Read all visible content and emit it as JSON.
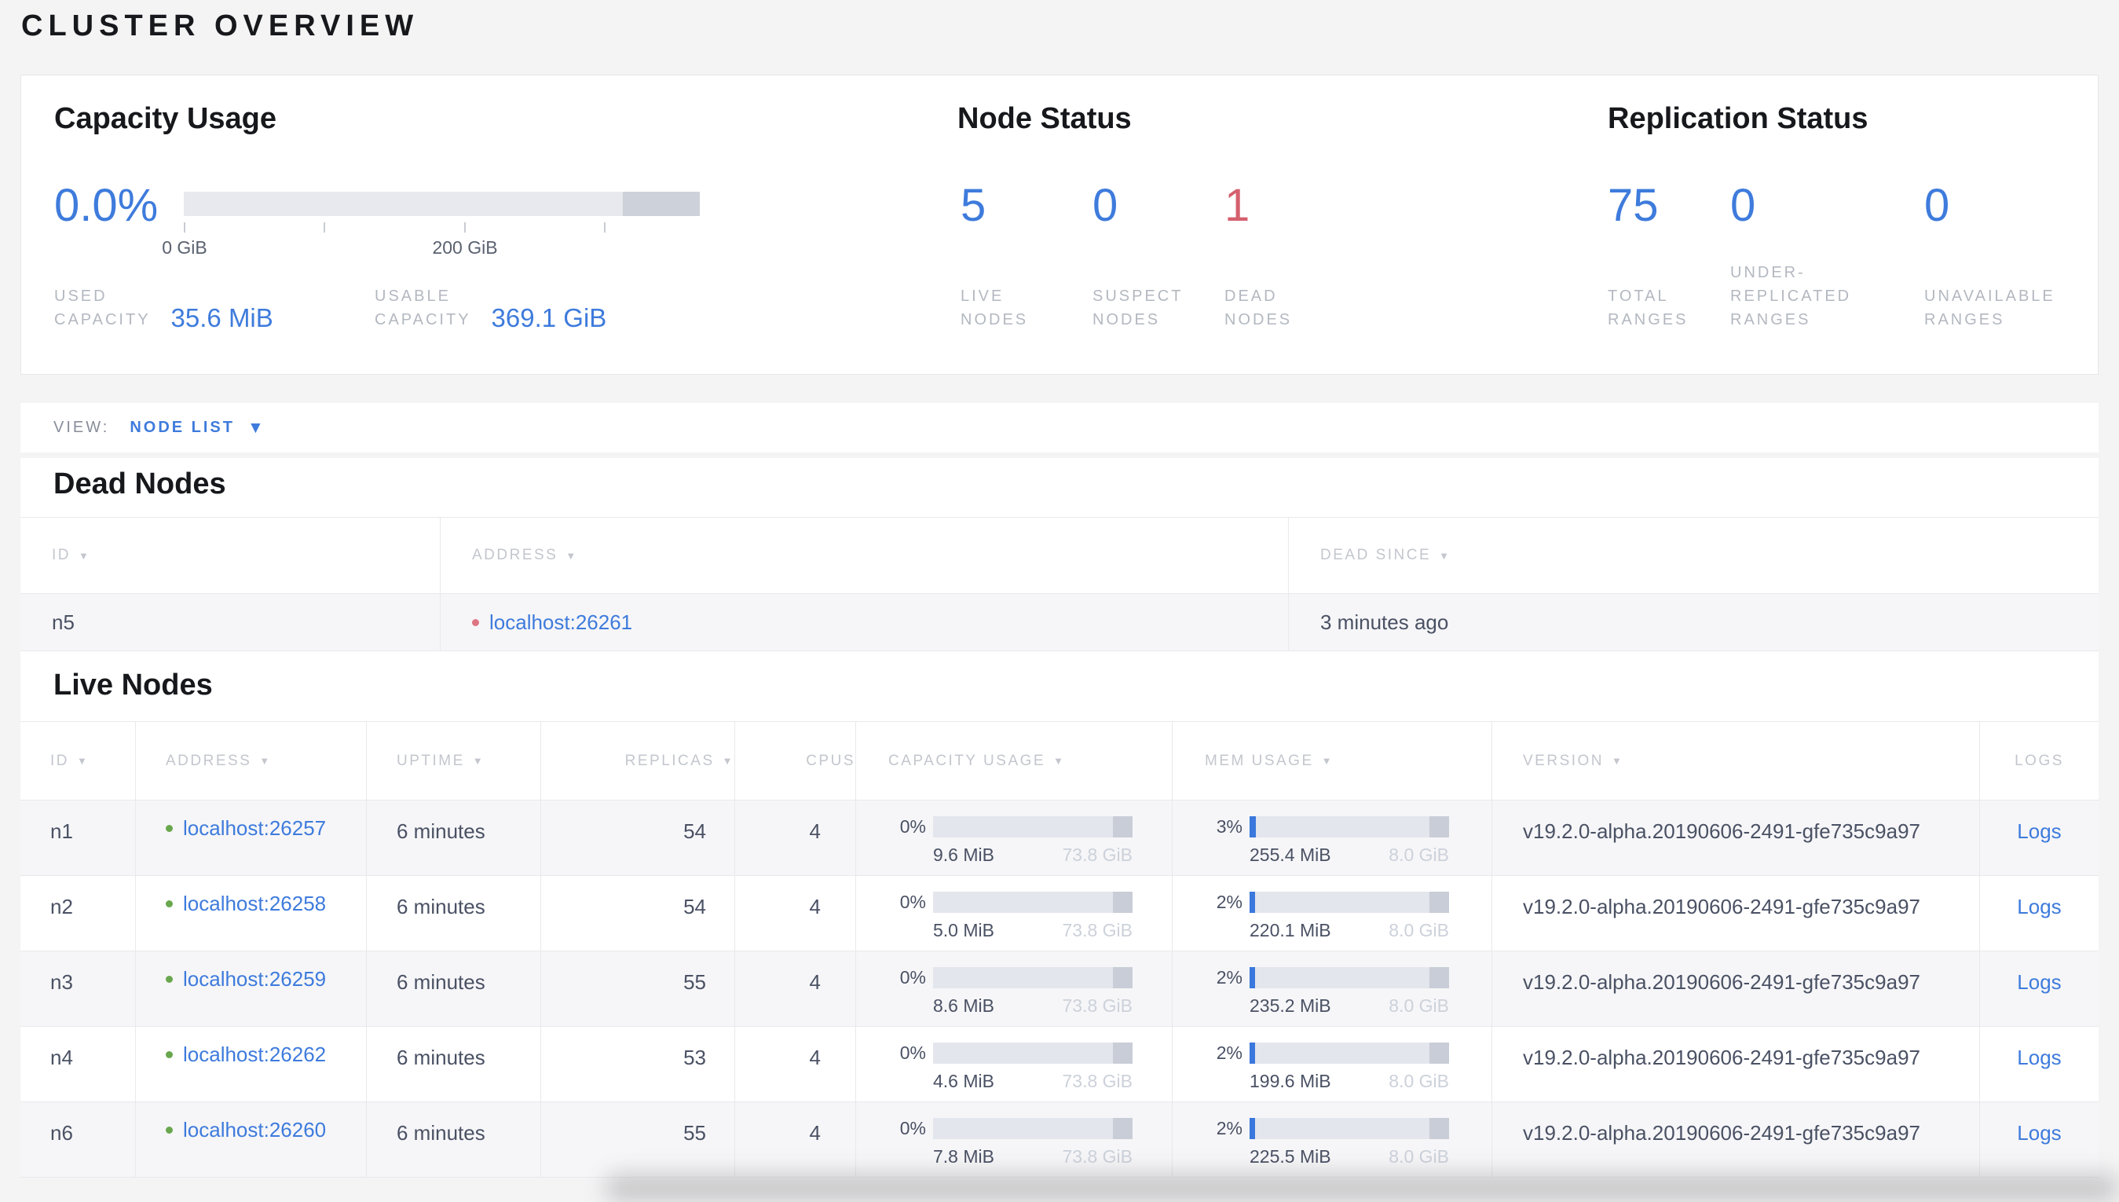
{
  "page": {
    "title": "CLUSTER OVERVIEW"
  },
  "colors": {
    "accent_blue": "#3e7bdc",
    "dead_red": "#d5606e",
    "live_green": "#69a74e",
    "bar_track": "#e4e6ed",
    "bar_end": "#c9cdd7"
  },
  "summary": {
    "capacity": {
      "title": "Capacity Usage",
      "percent": "0.0%",
      "tick_labels": [
        "0 GiB",
        "200 GiB"
      ],
      "stats": [
        {
          "lines": [
            "USED",
            "CAPACITY"
          ],
          "value": "35.6 MiB"
        },
        {
          "lines": [
            "USABLE",
            "CAPACITY"
          ],
          "value": "369.1 GiB"
        }
      ]
    },
    "nodes": {
      "title": "Node Status",
      "stats": [
        {
          "value": "5",
          "lines": [
            "LIVE",
            "NODES"
          ]
        },
        {
          "value": "0",
          "lines": [
            "SUSPECT",
            "NODES"
          ]
        },
        {
          "value": "1",
          "lines": [
            "DEAD",
            "NODES"
          ]
        }
      ]
    },
    "replication": {
      "title": "Replication Status",
      "stats": [
        {
          "value": "75",
          "lines": [
            "TOTAL",
            "RANGES"
          ]
        },
        {
          "value": "0",
          "lines": [
            "UNDER-",
            "REPLICATED",
            "RANGES"
          ]
        },
        {
          "value": "0",
          "lines": [
            "UNAVAILABLE",
            "RANGES"
          ]
        }
      ]
    }
  },
  "view_bar": {
    "label": "VIEW:",
    "selected": "NODE LIST"
  },
  "dead_nodes": {
    "title": "Dead Nodes",
    "columns": [
      "ID",
      "ADDRESS",
      "DEAD SINCE"
    ],
    "rows": [
      {
        "id": "n5",
        "address": "localhost:26261",
        "dead_since": "3 minutes ago"
      }
    ]
  },
  "live_nodes": {
    "title": "Live Nodes",
    "columns": [
      "ID",
      "ADDRESS",
      "UPTIME",
      "REPLICAS",
      "CPUS",
      "CAPACITY USAGE",
      "MEM USAGE",
      "VERSION",
      "LOGS"
    ],
    "logs_label": "Logs",
    "rows": [
      {
        "id": "n1",
        "address": "localhost:26257",
        "uptime": "6 minutes",
        "replicas": "54",
        "cpus": "4",
        "capacity": {
          "pct": "0%",
          "pct_num": 0,
          "used": "9.6 MiB",
          "total": "73.8 GiB"
        },
        "mem": {
          "pct": "3%",
          "pct_num": 3,
          "used": "255.4 MiB",
          "total": "8.0 GiB"
        },
        "version": "v19.2.0-alpha.20190606-2491-gfe735c9a97"
      },
      {
        "id": "n2",
        "address": "localhost:26258",
        "uptime": "6 minutes",
        "replicas": "54",
        "cpus": "4",
        "capacity": {
          "pct": "0%",
          "pct_num": 0,
          "used": "5.0 MiB",
          "total": "73.8 GiB"
        },
        "mem": {
          "pct": "2%",
          "pct_num": 2,
          "used": "220.1 MiB",
          "total": "8.0 GiB"
        },
        "version": "v19.2.0-alpha.20190606-2491-gfe735c9a97"
      },
      {
        "id": "n3",
        "address": "localhost:26259",
        "uptime": "6 minutes",
        "replicas": "55",
        "cpus": "4",
        "capacity": {
          "pct": "0%",
          "pct_num": 0,
          "used": "8.6 MiB",
          "total": "73.8 GiB"
        },
        "mem": {
          "pct": "2%",
          "pct_num": 2,
          "used": "235.2 MiB",
          "total": "8.0 GiB"
        },
        "version": "v19.2.0-alpha.20190606-2491-gfe735c9a97"
      },
      {
        "id": "n4",
        "address": "localhost:26262",
        "uptime": "6 minutes",
        "replicas": "53",
        "cpus": "4",
        "capacity": {
          "pct": "0%",
          "pct_num": 0,
          "used": "4.6 MiB",
          "total": "73.8 GiB"
        },
        "mem": {
          "pct": "2%",
          "pct_num": 2,
          "used": "199.6 MiB",
          "total": "8.0 GiB"
        },
        "version": "v19.2.0-alpha.20190606-2491-gfe735c9a97"
      },
      {
        "id": "n6",
        "address": "localhost:26260",
        "uptime": "6 minutes",
        "replicas": "55",
        "cpus": "4",
        "capacity": {
          "pct": "0%",
          "pct_num": 0,
          "used": "7.8 MiB",
          "total": "73.8 GiB"
        },
        "mem": {
          "pct": "2%",
          "pct_num": 2,
          "used": "225.5 MiB",
          "total": "8.0 GiB"
        },
        "version": "v19.2.0-alpha.20190606-2491-gfe735c9a97"
      }
    ]
  }
}
